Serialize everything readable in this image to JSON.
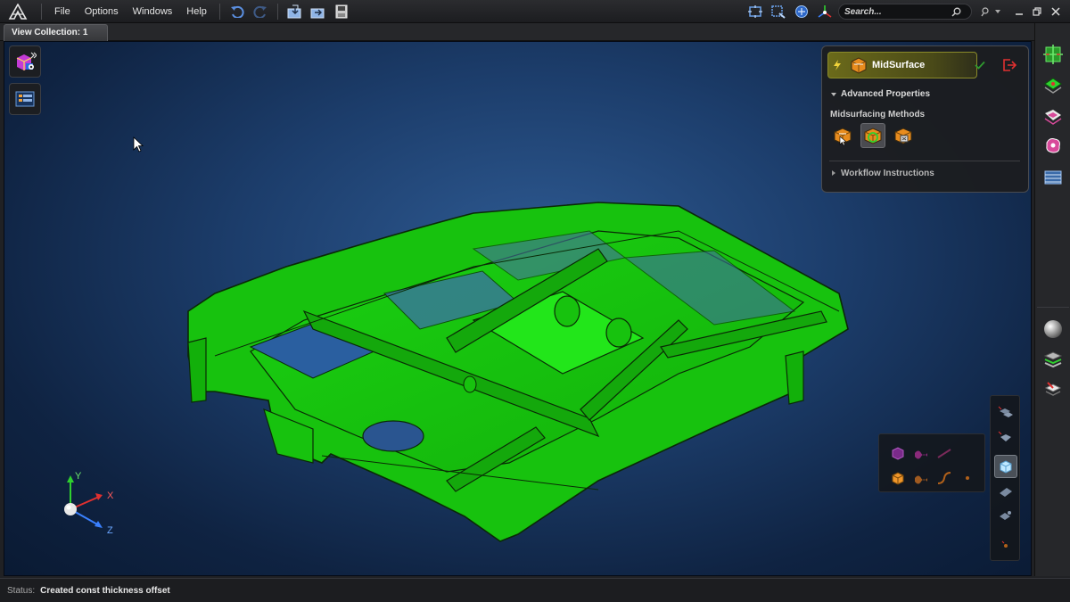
{
  "menu": {
    "file": "File",
    "options": "Options",
    "windows": "Windows",
    "help": "Help"
  },
  "search": {
    "placeholder": "Search..."
  },
  "tabs": {
    "view_collection": "View Collection: 1"
  },
  "panel": {
    "title": "MidSurface",
    "advanced_properties": "Advanced Properties",
    "midsurfacing_methods": "Midsurfacing Methods",
    "workflow_instructions": "Workflow Instructions"
  },
  "triad": {
    "x": "X",
    "y": "Y",
    "z": "Z"
  },
  "status": {
    "label": "Status:",
    "text": "Created const thickness offset"
  },
  "colors": {
    "model_green": "#16c40e",
    "accent_yellow": "#c9c93a",
    "viewport_blue": "#1c3d6b",
    "exit_red": "#e03030"
  }
}
